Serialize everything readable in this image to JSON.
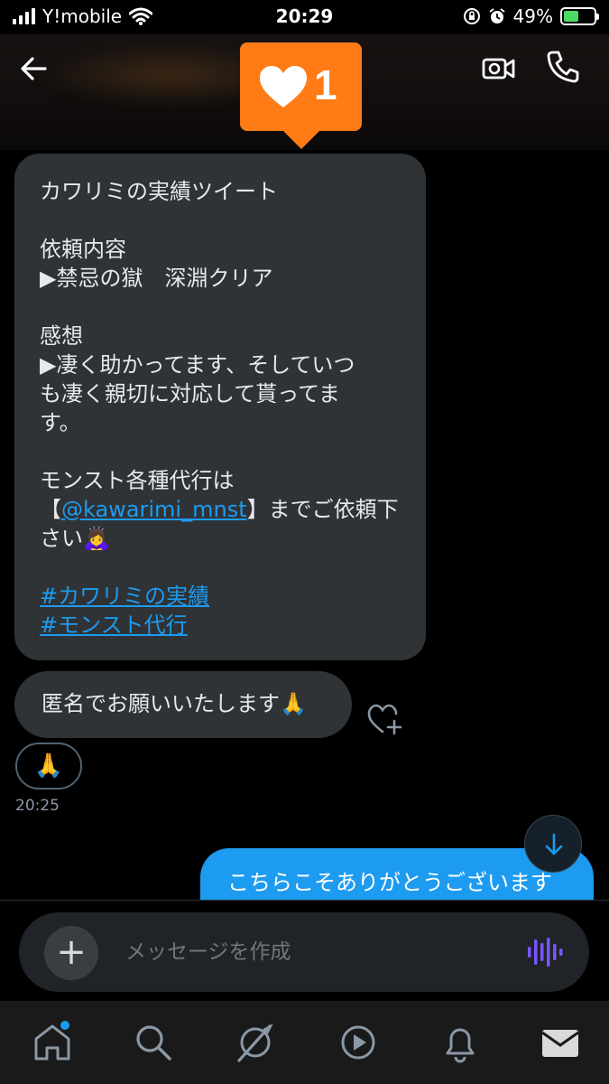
{
  "status_bar": {
    "carrier": "Y!mobile",
    "time": "20:29",
    "battery": "49%",
    "battery_level": 0.49
  },
  "header": {
    "back_icon": "back-arrow-icon",
    "video_icon": "video-call-icon",
    "phone_icon": "phone-icon"
  },
  "notification": {
    "icon": "heart-icon",
    "count": "1",
    "color": "#ff7b15"
  },
  "messages": {
    "main": {
      "title": "カワリミの実績ツイート",
      "request_label": "依頼内容",
      "request_value": "▶禁忌の獄　深淵クリア",
      "impression_label": "感想",
      "impression_value": "▶凄く助かってます、そしていつ\nも凄く親切に対応して貰ってま\nす。",
      "service_line": "モンスト各種代行は",
      "bracket_open": "【",
      "handle": "@kawarimi_mnst",
      "bracket_close_text": "】までご依頼下",
      "closing": "さい🙇‍♀️",
      "hashtag1": "#カワリミの実績",
      "hashtag2": "#モンスト代行"
    },
    "second": {
      "text": "匿名でお願いいたします🙏"
    },
    "reaction": {
      "emoji": "🙏"
    },
    "timestamp": "20:25",
    "sent": {
      "text": "こちらこそありがとうございます"
    }
  },
  "composer": {
    "placeholder": "メッセージを作成",
    "add_icon": "+"
  },
  "tabbar": {
    "items": [
      "home-icon",
      "search-icon",
      "spaces-icon",
      "video-icon",
      "notifications-icon",
      "messages-icon"
    ]
  },
  "colors": {
    "accent": "#1d9bf0",
    "bubble": "#2f3336",
    "voice": "#7856ff"
  }
}
